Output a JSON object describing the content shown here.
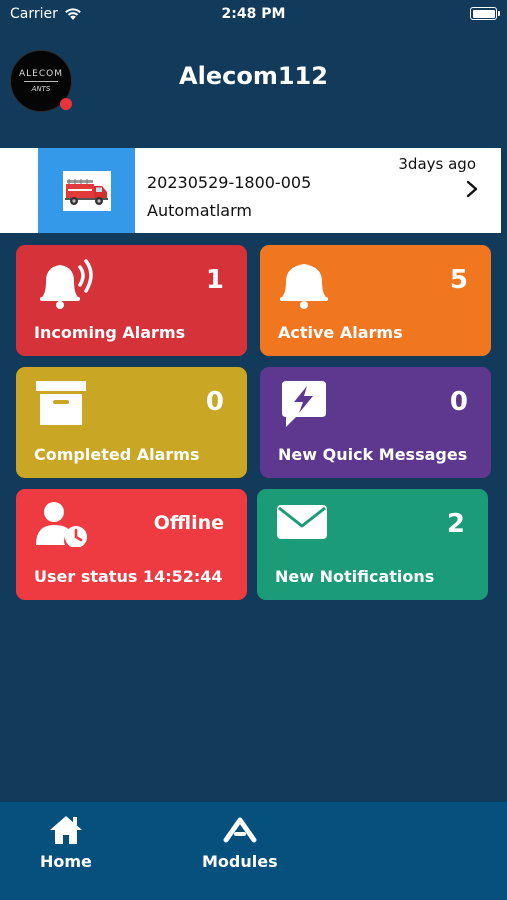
{
  "status_bar": {
    "carrier": "Carrier",
    "time": "2:48 PM"
  },
  "header": {
    "title": "Alecom112",
    "logo_text_top": "ALECOM",
    "logo_text_bottom": "ANTS",
    "status_dot_color": "#e8333a"
  },
  "latest_alarm": {
    "id": "20230529-1800-005",
    "type": "Automatlarm",
    "age": "3days ago",
    "icon": "fire-truck-icon"
  },
  "tiles": [
    {
      "label": "Incoming Alarms",
      "value": "1",
      "color": "#d63239",
      "icon": "ringing-bell-icon"
    },
    {
      "label": "Active Alarms",
      "value": "5",
      "color": "#f0761f",
      "icon": "bell-icon"
    },
    {
      "label": "Completed Alarms",
      "value": "0",
      "color": "#c9a724",
      "icon": "archive-box-icon"
    },
    {
      "label": "New Quick Messages",
      "value": "0",
      "color": "#5e378f",
      "icon": "flash-message-icon"
    },
    {
      "label": "User status 14:52:44",
      "value": "Offline",
      "color": "#ee3b42",
      "icon": "user-clock-icon"
    },
    {
      "label": "New Notifications",
      "value": "2",
      "color": "#1c9b78",
      "icon": "envelope-icon"
    }
  ],
  "tab_bar": {
    "items": [
      {
        "label": "Home",
        "icon": "home-icon"
      },
      {
        "label": "Modules",
        "icon": "modules-chevron-icon"
      }
    ]
  }
}
